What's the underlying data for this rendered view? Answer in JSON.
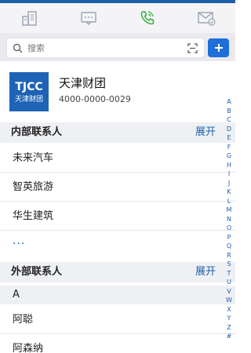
{
  "tabs": [
    {
      "id": "building-icon",
      "active": false
    },
    {
      "id": "chat-card-icon",
      "active": false
    },
    {
      "id": "phone-icon",
      "active": true
    },
    {
      "id": "mail-icon",
      "active": false
    }
  ],
  "colors": {
    "accent": "#1f5fa8",
    "active_tab": "#3db24a",
    "button": "#1e6fd9"
  },
  "search": {
    "placeholder": "搜索"
  },
  "company": {
    "logo_line1": "TJCC",
    "logo_line2": "天津财团",
    "name": "天津财团",
    "phone": "4000-0000-0029"
  },
  "internal": {
    "title": "内部联系人",
    "action": "展开",
    "items": [
      "未来汽车",
      "智英旅游",
      "华生建筑"
    ],
    "more": "···"
  },
  "external": {
    "title": "外部联系人",
    "action": "展开",
    "group_letter": "A",
    "items": [
      "阿聪",
      "阿森纳"
    ]
  },
  "index_letters": [
    "A",
    "B",
    "C",
    "D",
    "E",
    "F",
    "G",
    "H",
    "I",
    "J",
    "K",
    "L",
    "M",
    "N",
    "O",
    "P",
    "Q",
    "R",
    "S",
    "T",
    "U",
    "V",
    "W",
    "X",
    "Y",
    "Z",
    "#"
  ]
}
